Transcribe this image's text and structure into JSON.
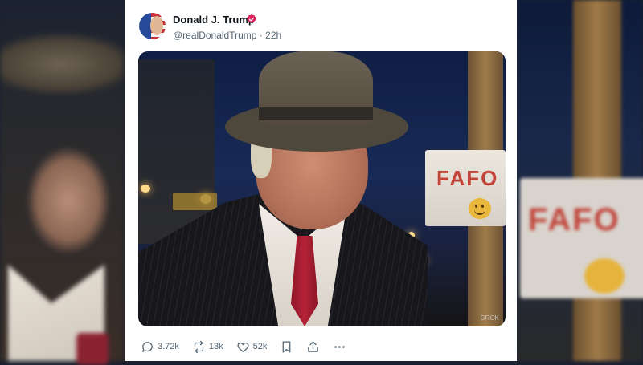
{
  "backdrop": {
    "sign_text": "FAFO"
  },
  "post": {
    "author": {
      "name": "Donald J. Trump",
      "handle": "@realDonaldTrump",
      "time": "22h",
      "separator": "·",
      "verified": true
    },
    "image": {
      "sign_text": "FAFO",
      "watermark": "GROK"
    },
    "actions": {
      "replies": "3.72k",
      "reposts": "13k",
      "likes": "52k"
    }
  },
  "colors": {
    "verified_badge": "#e0245e",
    "action_icons": "#536471",
    "sign_lettering": "#c24439"
  },
  "icons": [
    "reply-icon",
    "repost-icon",
    "like-icon",
    "bookmark-icon",
    "share-icon",
    "more-icon",
    "verified-icon"
  ]
}
